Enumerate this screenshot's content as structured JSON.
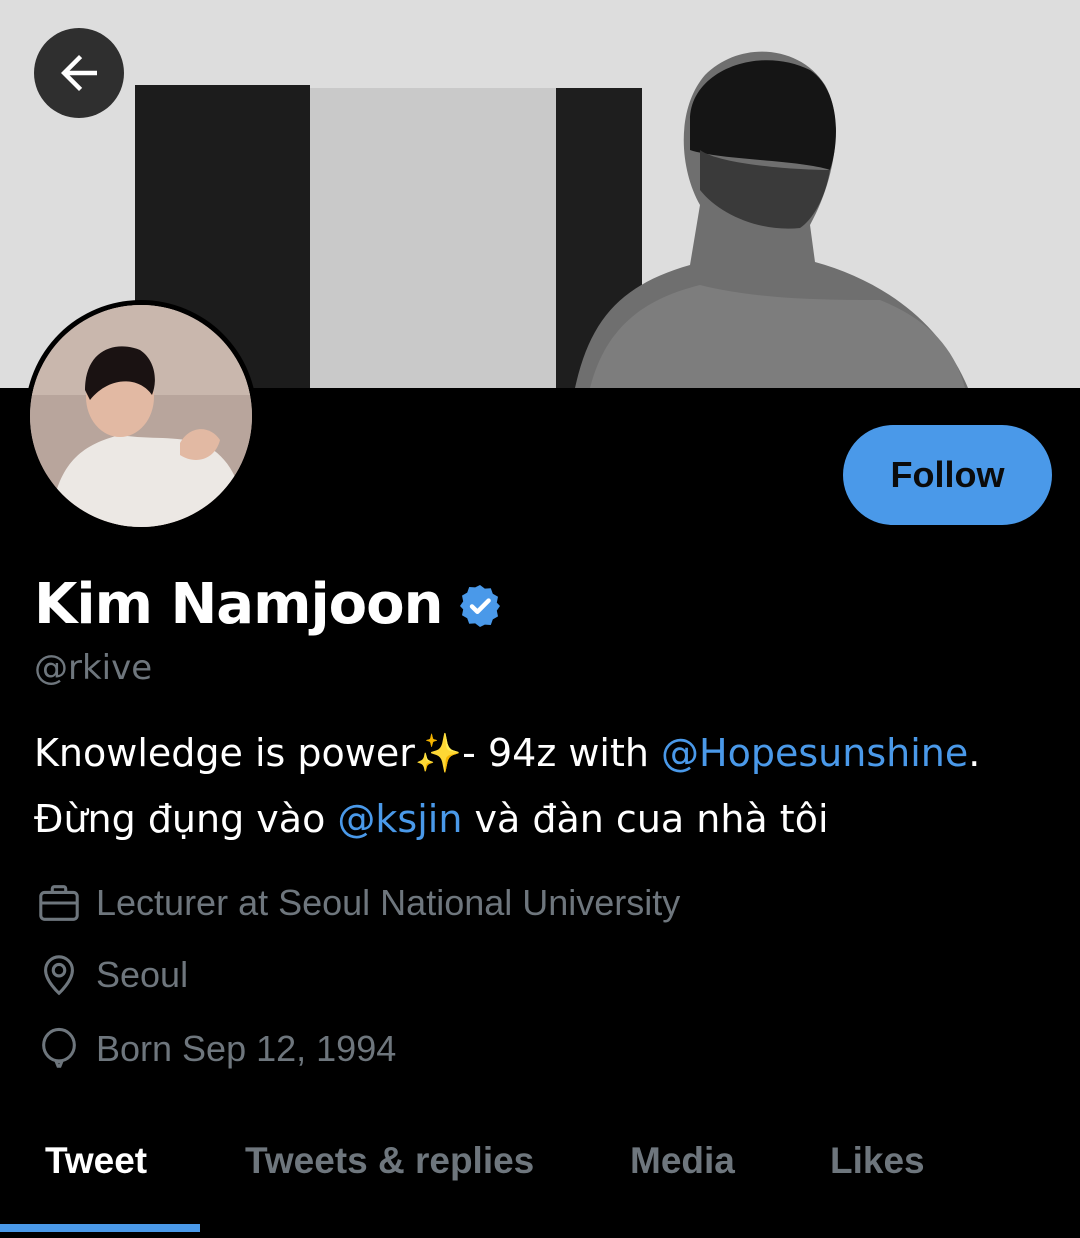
{
  "header": {
    "back_icon": "arrow-left-icon"
  },
  "profile": {
    "display_name": "Kim Namjoon",
    "verified_icon": "verified-badge-icon",
    "handle": "@rkive",
    "follow_label": "Follow",
    "bio": {
      "line1_text": "Knowledge is power✨- 94z with ",
      "line1_mention": "@Hopesunshine",
      "line1_end": ".",
      "line2_text": "Đừng đụng vào ",
      "line2_mention": "@ksjin",
      "line2_end": " và đàn cua nhà tôi"
    },
    "meta": {
      "job": "Lecturer at Seoul National University",
      "job_icon": "briefcase-icon",
      "location": "Seoul",
      "location_icon": "location-pin-icon",
      "birth": "Born Sep 12, 1994",
      "birth_icon": "balloon-icon"
    }
  },
  "tabs": [
    {
      "label": "Tweet",
      "active": true
    },
    {
      "label": "Tweets & replies",
      "active": false
    },
    {
      "label": "Media",
      "active": false
    },
    {
      "label": "Likes",
      "active": false
    }
  ],
  "colors": {
    "accent": "#4a99e9",
    "muted_text": "#6e767d",
    "background": "#000000"
  }
}
